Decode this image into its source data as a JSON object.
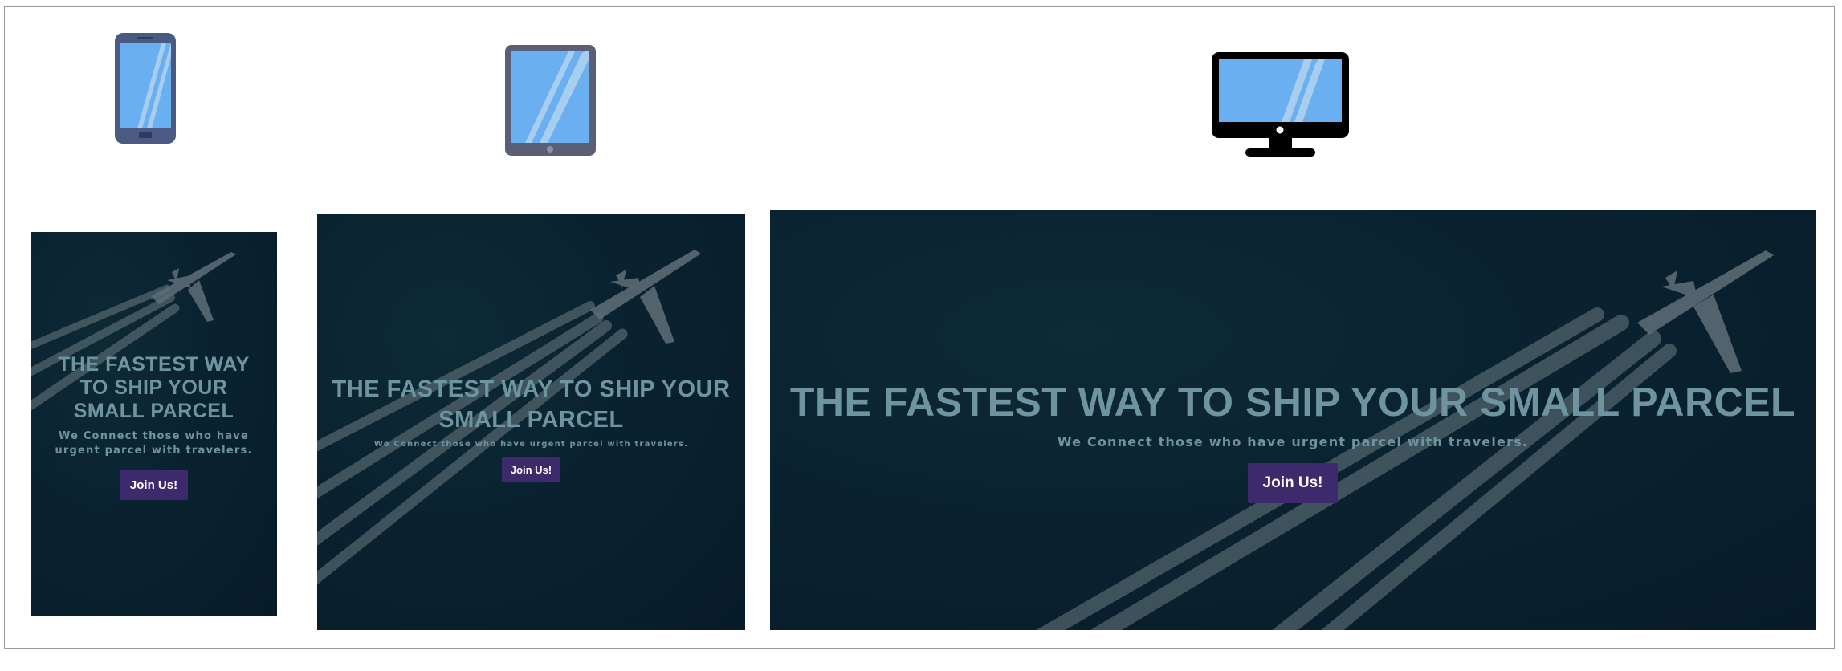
{
  "devices": [
    {
      "id": "phone",
      "icon": "smartphone-icon"
    },
    {
      "id": "tablet",
      "icon": "tablet-icon"
    },
    {
      "id": "desktop",
      "icon": "desktop-monitor-icon"
    }
  ],
  "hero": {
    "title": "THE FASTEST WAY TO SHIP YOUR SMALL PARCEL",
    "subtitle": "We Connect those who have urgent parcel with travelers.",
    "button_label": "Join Us!",
    "background_image": "airplane-contrails-photo"
  },
  "colors": {
    "hero_bg": "#0a2230",
    "heading": "#6e949f",
    "button_bg": "#3d2a6d",
    "button_text": "#ffffff",
    "icon_screen": "#6aaff0",
    "phone_body": "#4a5a82",
    "tablet_body": "#5a5f76",
    "monitor_body": "#000000"
  }
}
